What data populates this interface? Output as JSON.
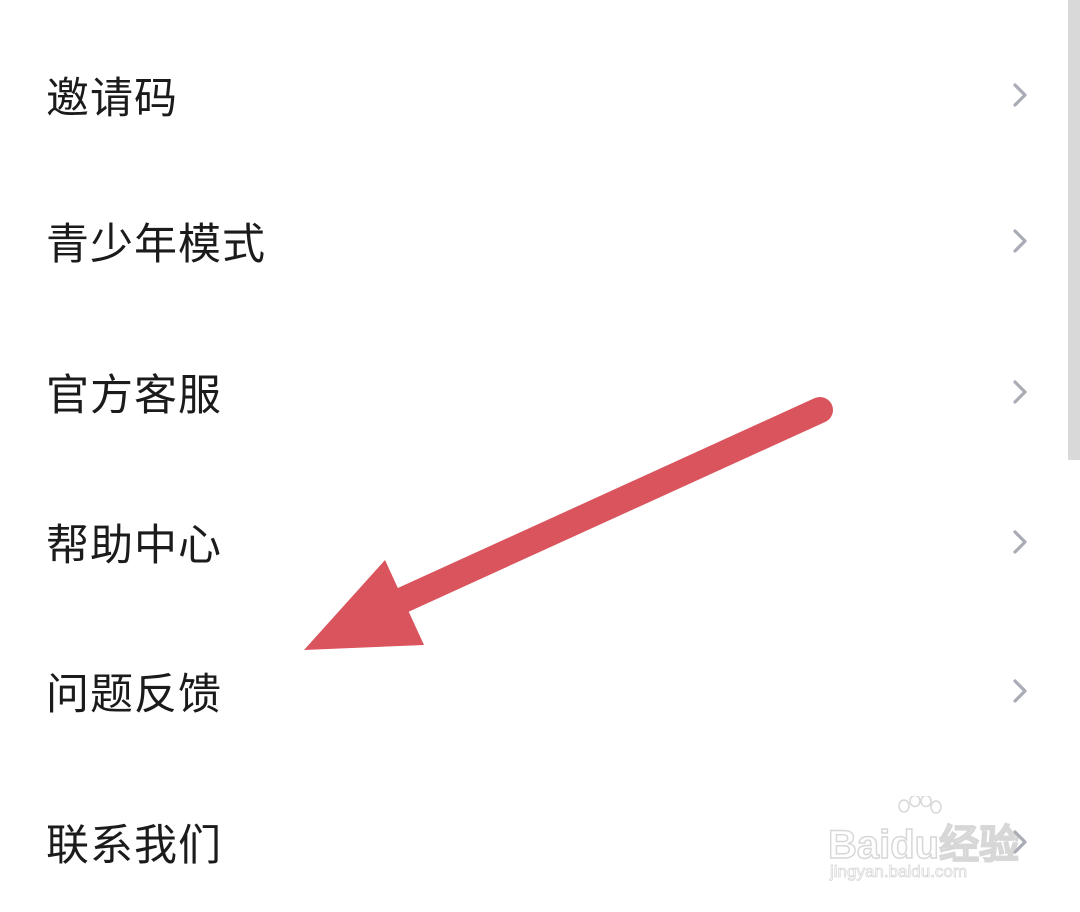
{
  "menu": {
    "items": [
      {
        "label": "邀请码",
        "icon": "chevron-right-icon"
      },
      {
        "label": "青少年模式",
        "icon": "chevron-right-icon"
      },
      {
        "label": "官方客服",
        "icon": "chevron-right-icon"
      },
      {
        "label": "帮助中心",
        "icon": "chevron-right-icon"
      },
      {
        "label": "问题反馈",
        "icon": "chevron-right-icon"
      },
      {
        "label": "联系我们",
        "icon": "chevron-right-icon"
      }
    ]
  },
  "annotation": {
    "icon": "red-arrow-icon",
    "color": "#d9545c",
    "target": "问题反馈"
  },
  "watermark": {
    "brand": "Baidu经验",
    "url": "jingyan.baidu.com"
  },
  "colors": {
    "text": "#1b1b1b",
    "chevron": "#a9abb5",
    "background": "#ffffff"
  }
}
